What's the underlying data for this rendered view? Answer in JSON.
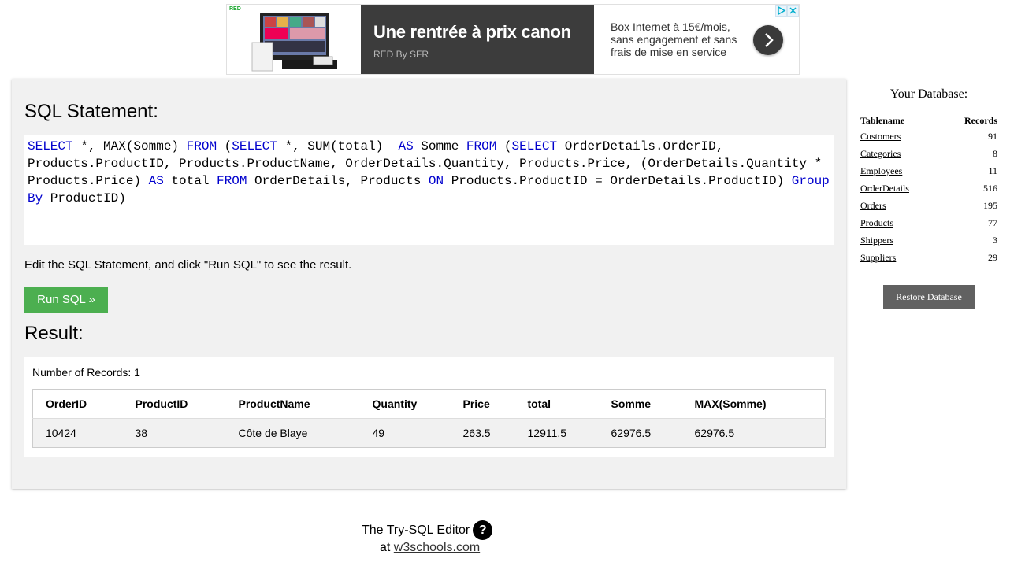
{
  "ad": {
    "badge": "RED",
    "headline": "Une rentrée à prix canon",
    "brand": "RED By SFR",
    "copy": "Box Internet à 15€/mois, sans engagement et sans frais de mise en service",
    "arrow_icon": "chevron-right-icon",
    "choices_icons": [
      "ad-choices-icon",
      "close-icon"
    ]
  },
  "editor": {
    "statement_heading": "SQL Statement:",
    "sql_tokens": [
      {
        "t": "SELECT",
        "kw": true
      },
      {
        "t": " *, MAX(Somme) ",
        "kw": false
      },
      {
        "t": "FROM",
        "kw": true
      },
      {
        "t": " (",
        "kw": false
      },
      {
        "t": "SELECT",
        "kw": true
      },
      {
        "t": " *, SUM(total)  ",
        "kw": false
      },
      {
        "t": "AS",
        "kw": true
      },
      {
        "t": " Somme ",
        "kw": false
      },
      {
        "t": "FROM",
        "kw": true
      },
      {
        "t": " (",
        "kw": false
      },
      {
        "t": "SELECT",
        "kw": true
      },
      {
        "t": " OrderDetails.OrderID, Products.ProductID, Products.ProductName, OrderDetails.Quantity, Products.Price, (OrderDetails.Quantity * Products.Price) ",
        "kw": false
      },
      {
        "t": "AS",
        "kw": true
      },
      {
        "t": " total ",
        "kw": false
      },
      {
        "t": "FROM",
        "kw": true
      },
      {
        "t": " OrderDetails, Products ",
        "kw": false
      },
      {
        "t": "ON",
        "kw": true
      },
      {
        "t": " Products.ProductID = OrderDetails.ProductID) ",
        "kw": false
      },
      {
        "t": "Group By",
        "kw": true
      },
      {
        "t": " ProductID)",
        "kw": false
      }
    ],
    "instructions": "Edit the SQL Statement, and click \"Run SQL\" to see the result.",
    "run_label": "Run SQL »",
    "keyword_color": "#0000cd",
    "run_color": "#4caf50"
  },
  "result": {
    "heading": "Result:",
    "record_count": "Number of Records: 1",
    "columns": [
      "OrderID",
      "ProductID",
      "ProductName",
      "Quantity",
      "Price",
      "total",
      "Somme",
      "MAX(Somme)"
    ],
    "rows": [
      [
        "10424",
        "38",
        "Côte de Blaye",
        "49",
        "263.5",
        "12911.5",
        "62976.5",
        "62976.5"
      ]
    ]
  },
  "sidebar": {
    "title": "Your Database:",
    "col_tablename": "Tablename",
    "col_records": "Records",
    "tables": [
      {
        "name": "Customers",
        "records": "91"
      },
      {
        "name": "Categories",
        "records": "8"
      },
      {
        "name": "Employees",
        "records": "11"
      },
      {
        "name": "OrderDetails",
        "records": "516"
      },
      {
        "name": "Orders",
        "records": "195"
      },
      {
        "name": "Products",
        "records": "77"
      },
      {
        "name": "Shippers",
        "records": "3"
      },
      {
        "name": "Suppliers",
        "records": "29"
      }
    ],
    "restore_label": "Restore Database"
  },
  "footer": {
    "editor_label": "The Try-SQL Editor",
    "help_glyph": "?",
    "at_label": "at",
    "site_link": "w3schools.com"
  }
}
